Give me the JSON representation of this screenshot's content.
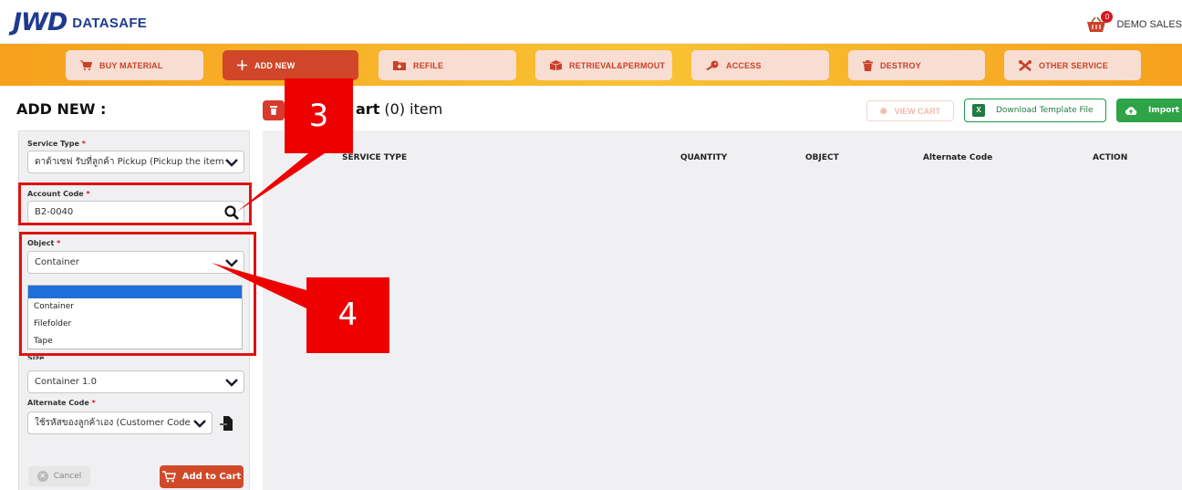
{
  "brand": {
    "mark": "JWD",
    "name": "DATASAFE"
  },
  "user": {
    "badge": "0",
    "name": "DEMO SALES"
  },
  "nav": {
    "buy_material": "BUY MATERIAL",
    "add_new": "ADD NEW",
    "refile": "REFILE",
    "retrieval": "RETRIEVAL&PERMOUT",
    "access": "ACCESS",
    "destroy": "DESTROY",
    "other_service": "OTHER SERVICE"
  },
  "form": {
    "title": "ADD NEW :",
    "required_mark": "*",
    "service_type": {
      "label": "Service Type",
      "value": "ดาต้าเซฟ รับที่ลูกค้า Pickup (Pickup the item"
    },
    "account_code": {
      "label": "Account Code",
      "value": "B2-0040"
    },
    "object": {
      "label": "Object",
      "value": "Container",
      "options": [
        "Container",
        "Filefolder",
        "Tape"
      ]
    },
    "size": {
      "label": "Size",
      "value": "Container 1.0"
    },
    "alternate_code": {
      "label": "Alternate Code",
      "value": "ใช้รหัสของลูกค้าเอง (Customer Code"
    },
    "cancel": "Cancel",
    "add_to_cart": "Add to Cart"
  },
  "cart": {
    "title_bold": "art",
    "title_rest": " (0) item",
    "view_cart": "VIEW CART",
    "download_template": "Download Template File",
    "import": "Import",
    "columns": [
      "SERVICE TYPE",
      "QUANTITY",
      "OBJECT",
      "Alternate Code",
      "ACTION"
    ]
  },
  "callouts": {
    "three": "3",
    "four": "4"
  },
  "colors": {
    "brand": "#1f3b8f",
    "accent": "#cf4728",
    "highlight": "#e01212",
    "nav_bg": "#f9c233"
  }
}
